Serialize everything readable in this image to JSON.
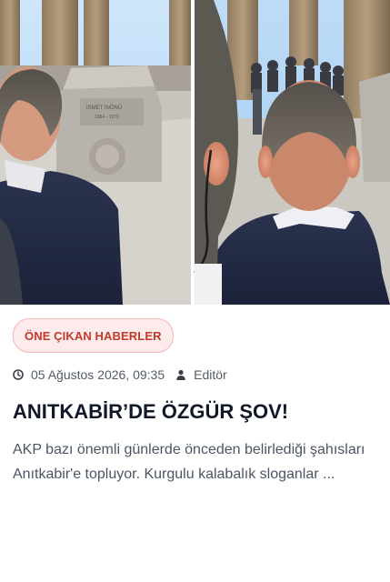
{
  "hero": {
    "image_alt": "Anıtkabir ziyareti — İsmet İnönü mezarı önünde",
    "tomb_inscription": "İSMET İNÖNÜ",
    "tomb_years": "1884 - 1973"
  },
  "category": {
    "label": "ÖNE ÇIKAN HABERLER",
    "color": "#c0392b"
  },
  "meta": {
    "date": "05 Ağustos 2026, 09:35",
    "author": "Editör",
    "date_icon": "clock-icon",
    "author_icon": "user-icon"
  },
  "article": {
    "title": "ANITKABİR’DE ÖZGÜR ŞOV!",
    "excerpt": "AKP bazı önemli günlerde önceden belirlediği şahısları Anıtkabir'e topluyor. Kurgulu kalabalık sloganlar ..."
  }
}
